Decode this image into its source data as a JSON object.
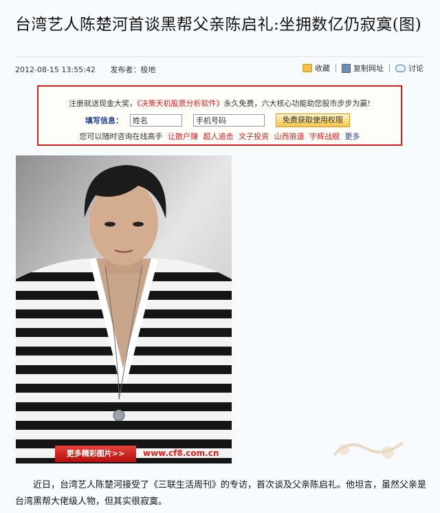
{
  "article": {
    "title": "台湾艺人陈楚河首谈黑帮父亲陈启礼:坐拥数亿仍寂寞(图)",
    "date": "2012-08-15 13:55:42",
    "publisher": "发布者：极地"
  },
  "toolbar": {
    "favorite": "收藏",
    "copy_url": "复制网址",
    "discuss": "讨论"
  },
  "promo": {
    "line1_a": "注册就送现金大奖，",
    "line1_red": "《决策天机股票分析软件》",
    "line1_b": "永久免费，六大核心功能助您股市步步为赢!",
    "label": "填写信息：",
    "name_value": "姓名",
    "phone_value": "手机号码",
    "button": "免费获取使用权限",
    "line3_prefix": "您可以随时咨询在线高手",
    "experts": [
      "让散户赚",
      "超人追击",
      "文子投资",
      "山西狼道",
      "宇辉战舰"
    ],
    "more": "更多"
  },
  "image": {
    "more_button": "更多精彩图片>>",
    "watermark": "www.cf8.com.cn"
  },
  "body": {
    "paragraph1": "近日，台湾艺人陈楚河接受了《三联生活周刊》的专访，首次谈及父亲陈启礼。他坦言，虽然父亲是台湾黑帮大佬级人物，但其实很寂寞。"
  },
  "colors": {
    "promo_border": "#d81f1f",
    "accent_blue": "#1f3f8c",
    "more_button": "#c41e1a"
  }
}
